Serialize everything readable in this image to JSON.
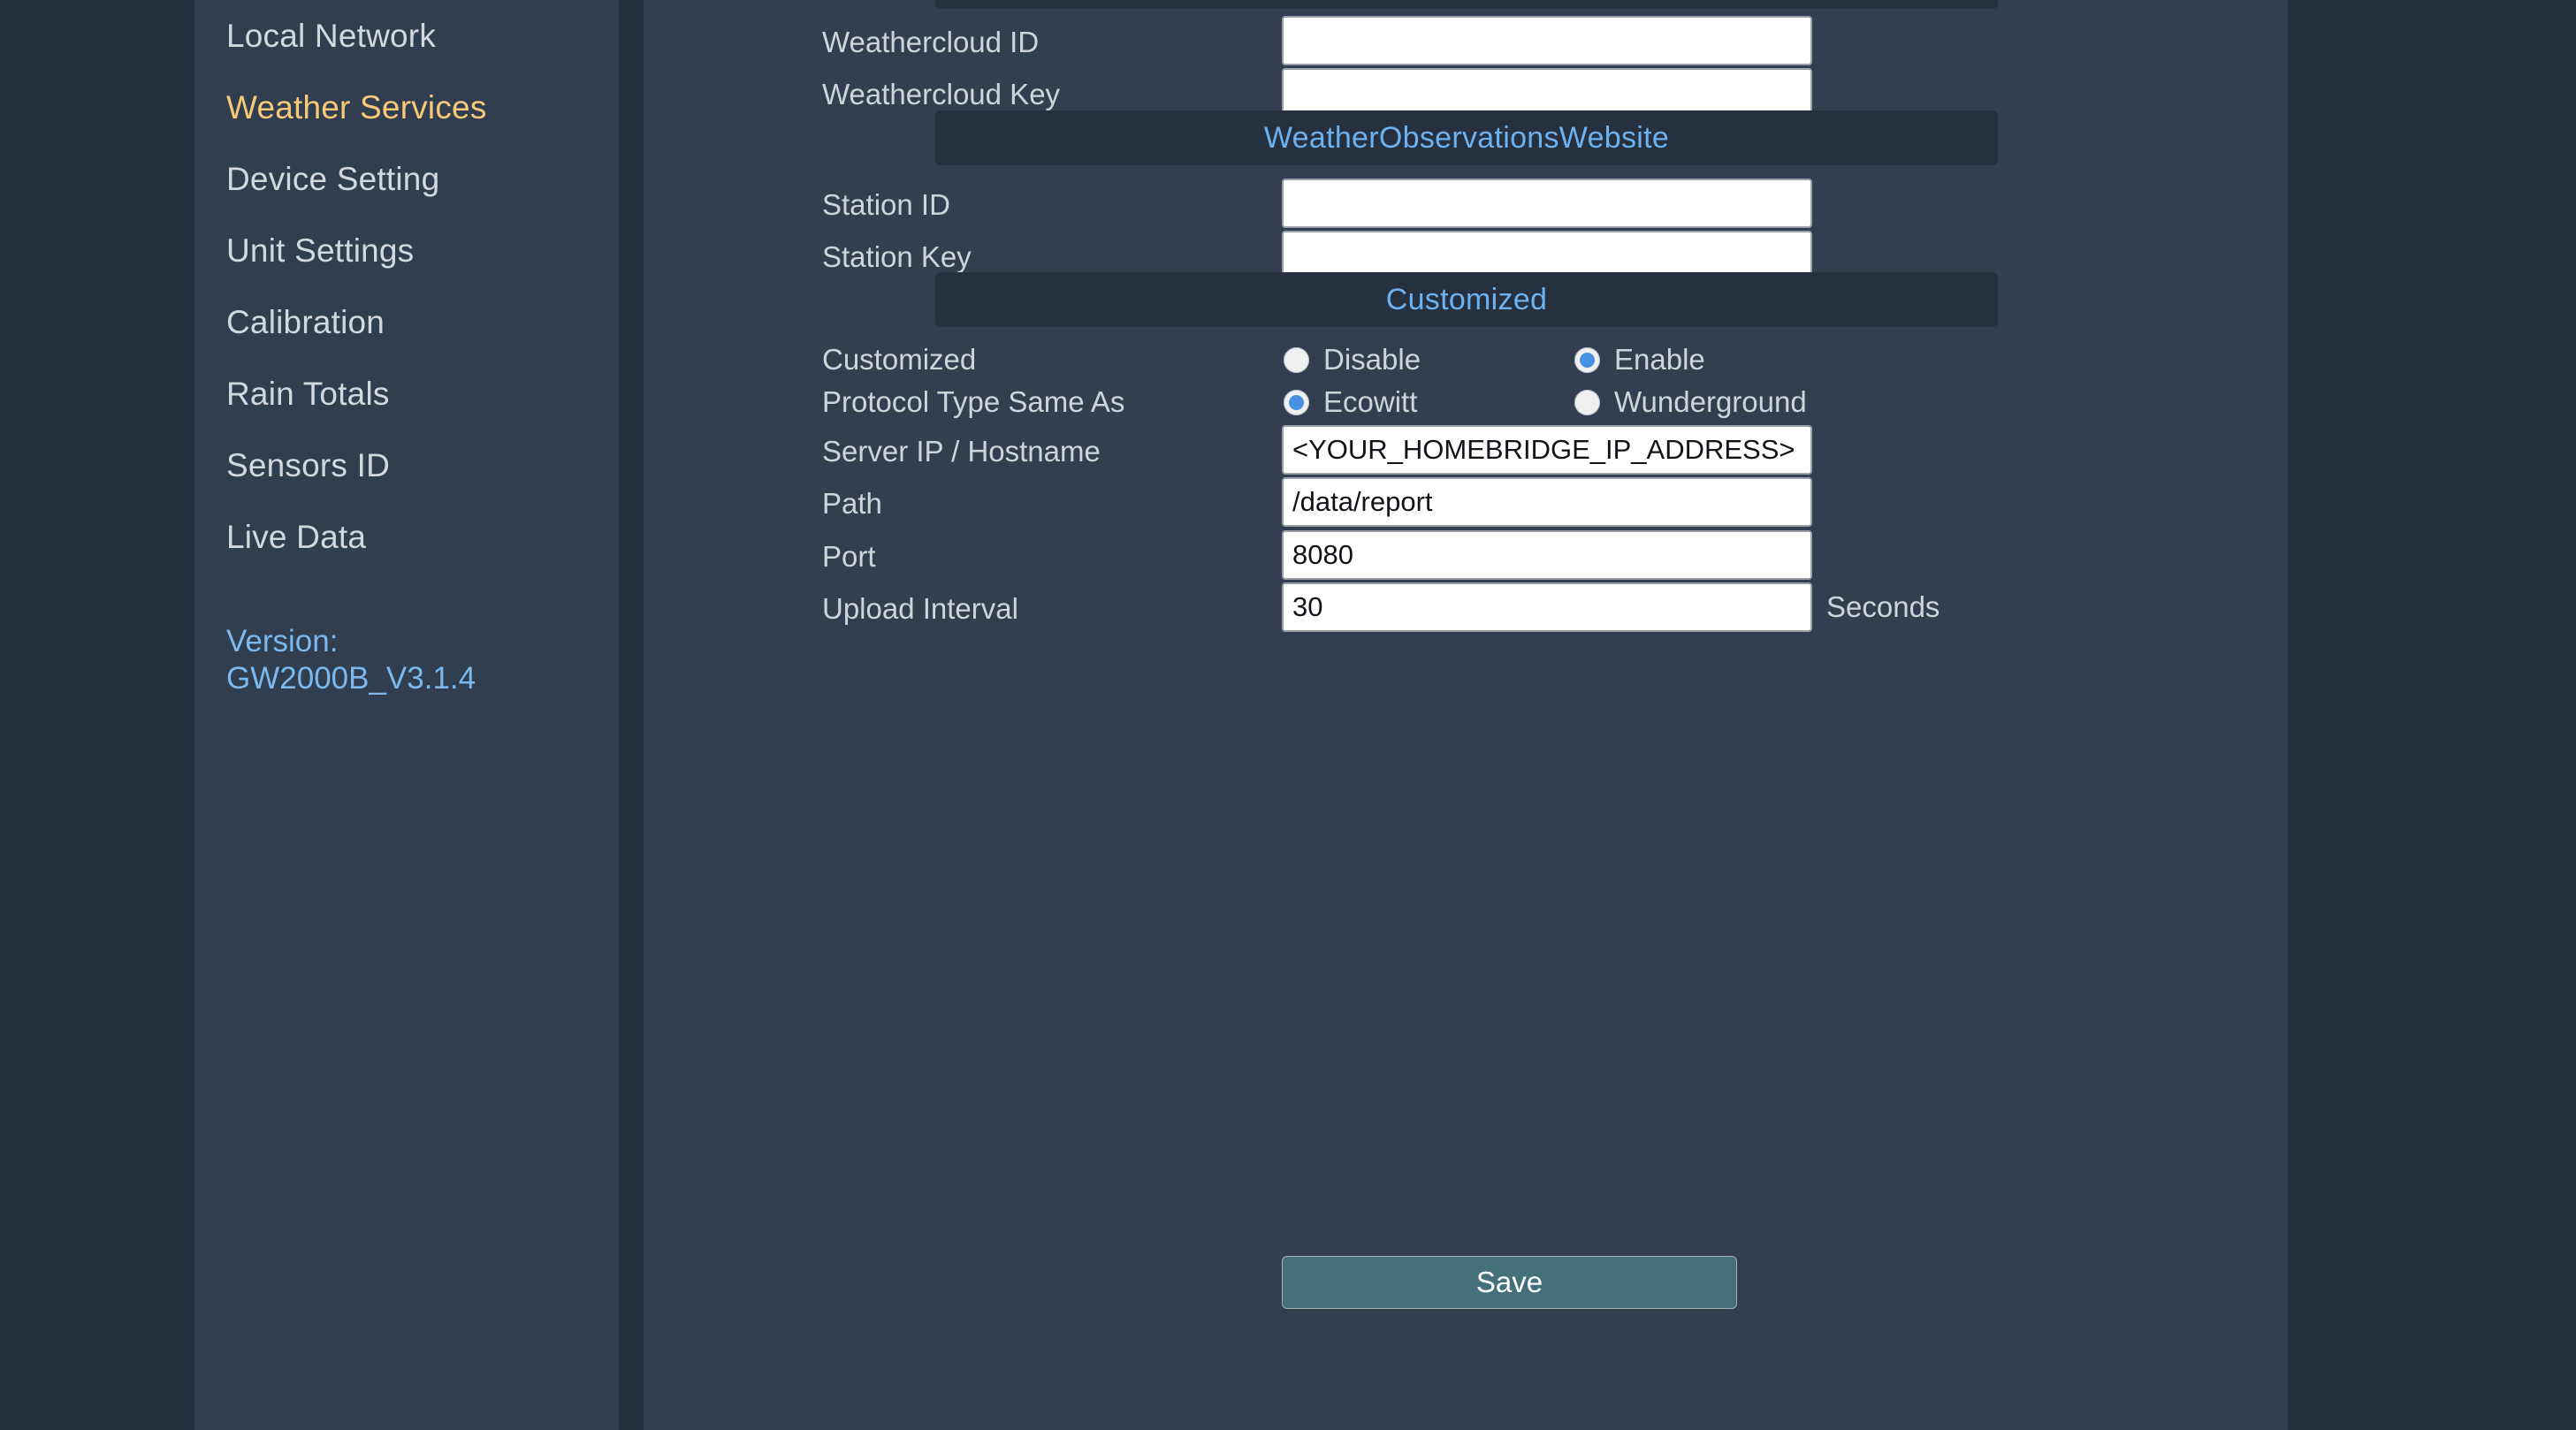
{
  "sidebar": {
    "items": [
      {
        "label": "Local Network",
        "active": false
      },
      {
        "label": "Weather Services",
        "active": true
      },
      {
        "label": "Device Setting",
        "active": false
      },
      {
        "label": "Unit Settings",
        "active": false
      },
      {
        "label": "Calibration",
        "active": false
      },
      {
        "label": "Rain Totals",
        "active": false
      },
      {
        "label": "Sensors ID",
        "active": false
      },
      {
        "label": "Live Data",
        "active": false
      }
    ],
    "version": "Version:\nGW2000B_V3.1.4"
  },
  "sections": {
    "weathercloud": {
      "fields": [
        {
          "label": "Weathercloud ID",
          "value": ""
        },
        {
          "label": "Weathercloud Key",
          "value": ""
        }
      ]
    },
    "wow": {
      "title": "WeatherObservationsWebsite",
      "fields": [
        {
          "label": "Station ID",
          "value": ""
        },
        {
          "label": "Station Key",
          "value": ""
        }
      ]
    },
    "customized": {
      "title": "Customized",
      "enable_row": {
        "label": "Customized",
        "options": [
          {
            "label": "Disable",
            "selected": false
          },
          {
            "label": "Enable",
            "selected": true
          }
        ]
      },
      "protocol_row": {
        "label": "Protocol Type Same As",
        "options": [
          {
            "label": "Ecowitt",
            "selected": true
          },
          {
            "label": "Wunderground",
            "selected": false
          }
        ]
      },
      "fields": [
        {
          "label": "Server IP / Hostname",
          "value": "<YOUR_HOMEBRIDGE_IP_ADDRESS>",
          "suffix": ""
        },
        {
          "label": "Path",
          "value": "/data/report",
          "suffix": ""
        },
        {
          "label": "Port",
          "value": "8080",
          "suffix": ""
        },
        {
          "label": "Upload Interval",
          "value": "30",
          "suffix": "Seconds"
        }
      ]
    }
  },
  "actions": {
    "save_label": "Save"
  },
  "colors": {
    "page_bg": "#22303f",
    "sidebar_bg": "#313e4f",
    "content_bg": "#333f51",
    "section_bar_bg": "#26303f",
    "section_title": "#6cb2f0",
    "active_nav": "#f8c978",
    "nav_text": "#d3d8de",
    "version_text": "#7ab8ee",
    "radio_selected": "#4a90e2",
    "save_bg": "#44707c"
  }
}
